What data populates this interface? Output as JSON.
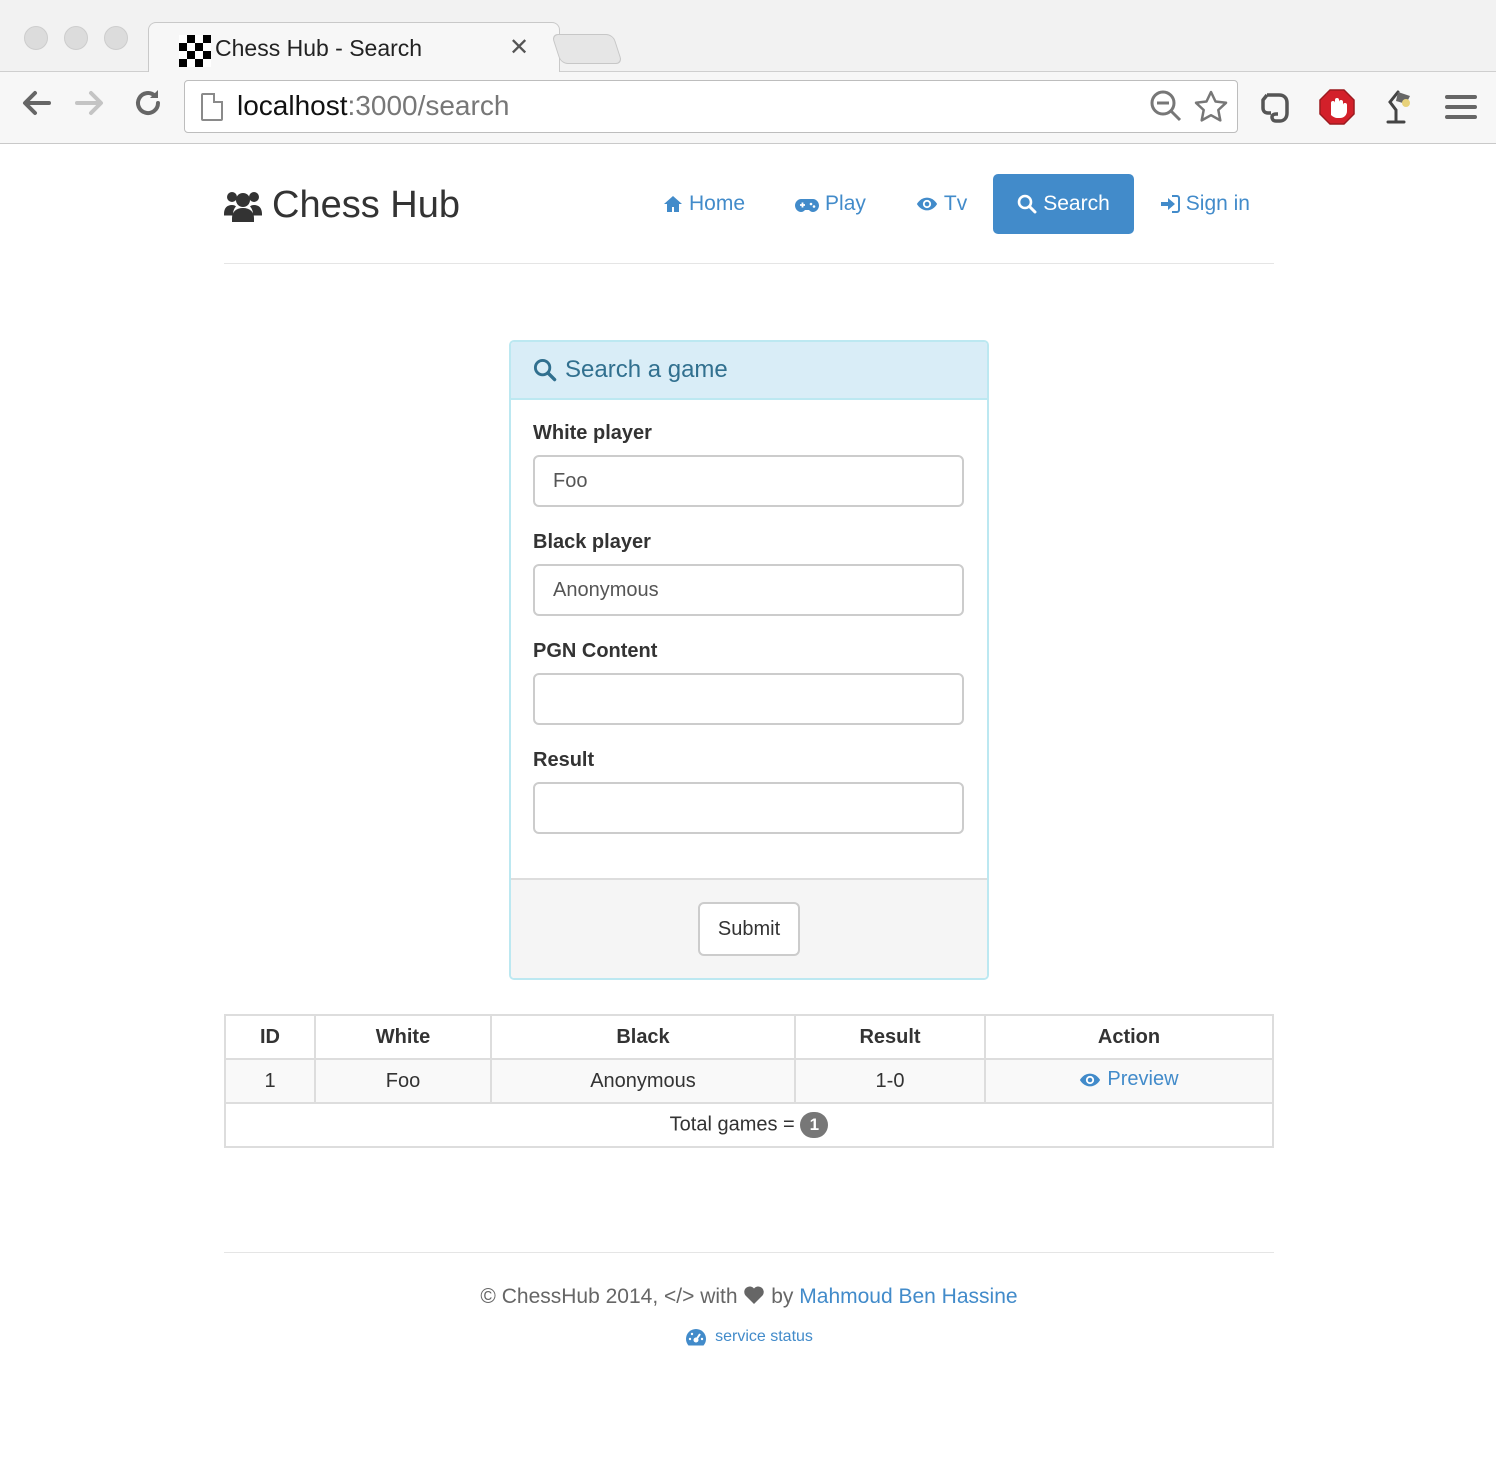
{
  "browser": {
    "tab_title": "Chess Hub - Search",
    "tab_close": "✕",
    "url_host": "localhost",
    "url_path": ":3000/search",
    "icons": [
      "back-arrow-icon",
      "forward-arrow-icon",
      "reload-icon",
      "zoom-out-icon",
      "bookmark-star-icon",
      "evernote-extension-icon",
      "adblock-extension-icon",
      "lamp-extension-icon",
      "menu-icon"
    ]
  },
  "header": {
    "brand": "Chess Hub",
    "nav": {
      "home": "Home",
      "play": "Play",
      "tv": "Tv",
      "search": "Search",
      "signin": "Sign in"
    },
    "active_item": "Search"
  },
  "search_panel": {
    "title": "Search a game",
    "fields": {
      "white_label": "White player",
      "white_value": "Foo",
      "black_label": "Black player",
      "black_value": "Anonymous",
      "pgn_label": "PGN Content",
      "pgn_value": "",
      "result_label": "Result",
      "result_value": ""
    },
    "submit": "Submit"
  },
  "results_table": {
    "headers": {
      "id": "ID",
      "white": "White",
      "black": "Black",
      "result": "Result",
      "action": "Action"
    },
    "rows": [
      {
        "id": "1",
        "white": "Foo",
        "black": "Anonymous",
        "result": "1-0",
        "action": "Preview"
      }
    ],
    "total_label": "Total games =",
    "total_count": "1"
  },
  "footer": {
    "copyright": "© ChessHub 2014, </> with",
    "by": "by",
    "author": "Mahmoud Ben Hassine",
    "status_link": "service status"
  },
  "colors": {
    "primary": "#428bca",
    "panel_heading_bg": "#d9edf7",
    "panel_heading_text": "#31708f",
    "panel_border": "#bce8f1"
  }
}
